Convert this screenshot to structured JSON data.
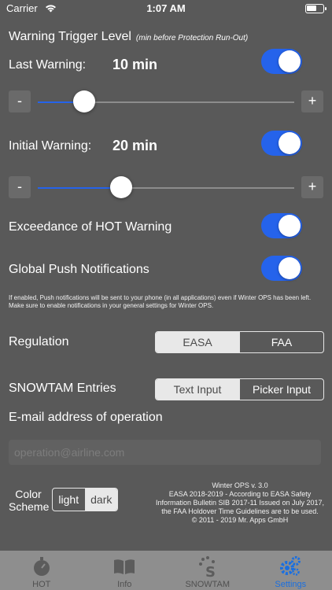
{
  "status": {
    "carrier": "Carrier",
    "time": "1:07 AM"
  },
  "trigger": {
    "title": "Warning Trigger Level",
    "subtitle": "(min before Protection Run-Out)"
  },
  "last_warning": {
    "label": "Last Warning:",
    "value": "10 min",
    "enabled": true,
    "slider_fraction": 0.18
  },
  "initial_warning": {
    "label": "Initial Warning:",
    "value": "20 min",
    "enabled": true,
    "slider_fraction": 0.33
  },
  "stepper": {
    "minus": "-",
    "plus": "+"
  },
  "exceedance": {
    "label": "Exceedance of HOT Warning",
    "enabled": true
  },
  "push": {
    "label": "Global Push Notifications",
    "enabled": true
  },
  "note": "If enabled, Push notifications will be sent to your phone (in all applications) even if Winter OPS has been left. Make sure to enable notifications in your general settings for Winter OPS.",
  "regulation": {
    "label": "Regulation",
    "options": [
      "EASA",
      "FAA"
    ],
    "selected": "EASA"
  },
  "snowtam": {
    "label": "SNOWTAM Entries",
    "options": [
      "Text Input",
      "Picker Input"
    ],
    "selected": "Text Input"
  },
  "email": {
    "label": "E-mail address of operation",
    "placeholder": "operation@airline.com",
    "value": ""
  },
  "color_scheme": {
    "label": "Color Scheme",
    "options": [
      "light",
      "dark"
    ],
    "selected": "dark"
  },
  "footer": {
    "version": "Winter OPS v. 3.0",
    "line": "EASA 2018-2019 - According to EASA Safety Information Bulletin SIB 2017-11 Issued on July 2017, the FAA Holdover Time Guidelines are to be used.",
    "copyright": "© 2011 - 2019 Mr. Apps GmbH"
  },
  "tabs": [
    {
      "label": "HOT",
      "icon": "stopwatch-icon"
    },
    {
      "label": "Info",
      "icon": "book-icon"
    },
    {
      "label": "SNOWTAM",
      "icon": "snowflake-icon"
    },
    {
      "label": "Settings",
      "icon": "gears-icon",
      "active": true
    }
  ],
  "colors": {
    "accent": "#2563eb",
    "background": "#595959",
    "tabbar": "#8e8e8e",
    "active_tab": "#1a6fe0"
  }
}
